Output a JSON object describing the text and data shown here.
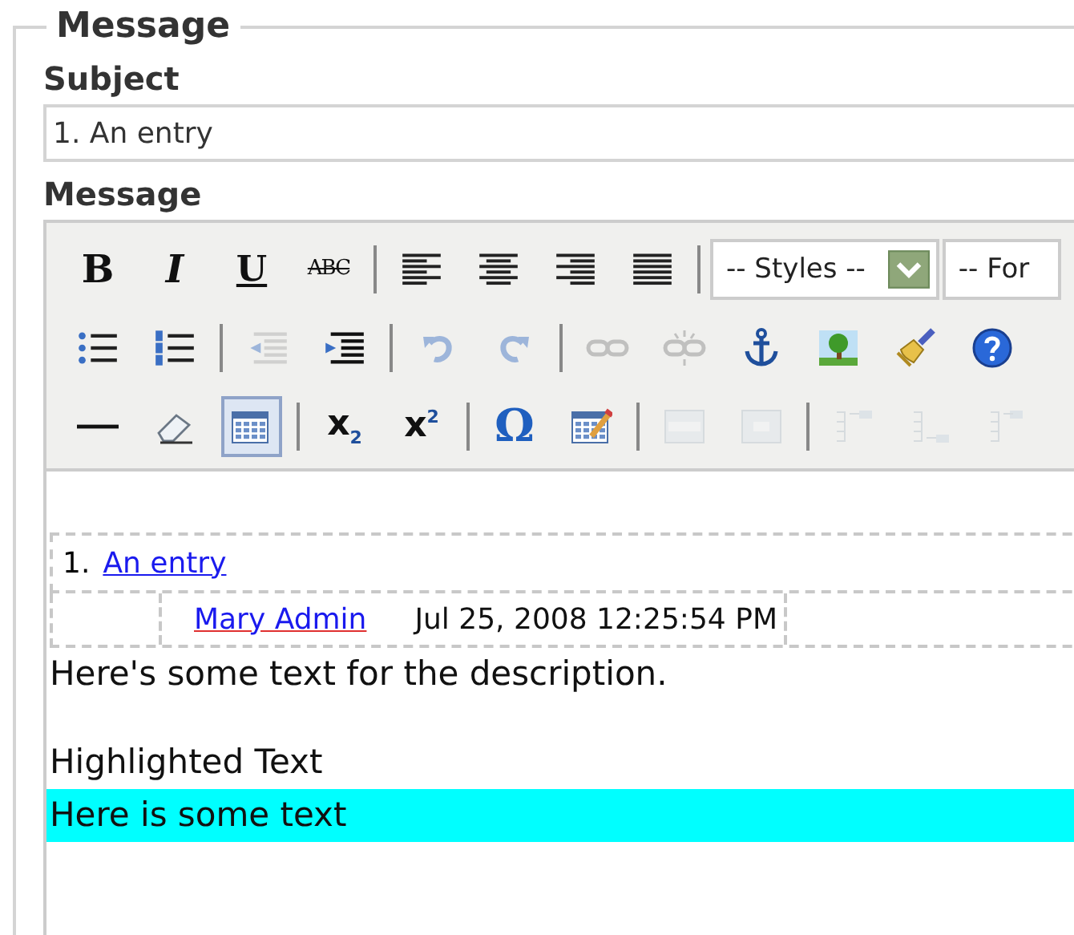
{
  "fieldset": {
    "legend": "Message"
  },
  "subject": {
    "label": "Subject",
    "value": "1. An entry"
  },
  "message_label": "Message",
  "toolbar": {
    "rows": [
      [
        {
          "kind": "bold",
          "label": "B",
          "disabled": false,
          "selected": false
        },
        {
          "kind": "italic",
          "label": "I",
          "disabled": false,
          "selected": false
        },
        {
          "kind": "underline",
          "label": "U",
          "disabled": false,
          "selected": false
        },
        {
          "kind": "strikethrough",
          "label": "ABC",
          "disabled": false,
          "selected": false
        },
        {
          "kind": "sep"
        },
        {
          "kind": "align-left",
          "disabled": false,
          "selected": false
        },
        {
          "kind": "align-center",
          "disabled": false,
          "selected": false
        },
        {
          "kind": "align-right",
          "disabled": false,
          "selected": false
        },
        {
          "kind": "justify",
          "disabled": false,
          "selected": false
        },
        {
          "kind": "sep"
        },
        {
          "kind": "select",
          "value": "-- Styles --"
        },
        {
          "kind": "select",
          "value": "-- For"
        }
      ],
      [
        {
          "kind": "bullet-list",
          "disabled": false,
          "selected": false
        },
        {
          "kind": "numbered-list",
          "disabled": false,
          "selected": false
        },
        {
          "kind": "sep"
        },
        {
          "kind": "outdent",
          "disabled": true,
          "selected": false
        },
        {
          "kind": "indent",
          "disabled": false,
          "selected": false
        },
        {
          "kind": "sep"
        },
        {
          "kind": "undo",
          "disabled": true,
          "selected": false
        },
        {
          "kind": "redo",
          "disabled": true,
          "selected": false
        },
        {
          "kind": "sep"
        },
        {
          "kind": "link",
          "disabled": true,
          "selected": false
        },
        {
          "kind": "unlink",
          "disabled": true,
          "selected": false
        },
        {
          "kind": "anchor",
          "disabled": false,
          "selected": false
        },
        {
          "kind": "image",
          "disabled": false,
          "selected": false
        },
        {
          "kind": "cleanup",
          "disabled": false,
          "selected": false
        },
        {
          "kind": "help",
          "disabled": false,
          "selected": false
        }
      ],
      [
        {
          "kind": "horizontal-rule",
          "disabled": false,
          "selected": false
        },
        {
          "kind": "eraser",
          "disabled": false,
          "selected": false
        },
        {
          "kind": "table",
          "disabled": false,
          "selected": true
        },
        {
          "kind": "sep"
        },
        {
          "kind": "subscript",
          "label": "x$_{2}$",
          "disabled": false,
          "selected": false
        },
        {
          "kind": "superscript",
          "label": "x$^{2}$",
          "disabled": false,
          "selected": false
        },
        {
          "kind": "sep"
        },
        {
          "kind": "special-char",
          "label": "Ω",
          "disabled": false,
          "selected": false
        },
        {
          "kind": "edit-table",
          "disabled": false,
          "selected": false
        },
        {
          "kind": "sep"
        },
        {
          "kind": "row-props",
          "disabled": true,
          "selected": false
        },
        {
          "kind": "cell-props",
          "disabled": true,
          "selected": false
        },
        {
          "kind": "sep"
        },
        {
          "kind": "row-before",
          "disabled": true,
          "selected": false
        },
        {
          "kind": "row-after",
          "disabled": true,
          "selected": false
        },
        {
          "kind": "col-before",
          "disabled": true,
          "selected": false
        }
      ]
    ]
  },
  "content": {
    "entry_number": "1.",
    "entry_link": "An entry",
    "author": "Mary Admin",
    "date": "Jul 25, 2008 12:25:54 PM",
    "description": "Here's some text for the description.",
    "paragraphs": [
      {
        "text": "Highlighted Text",
        "highlighted": false
      },
      {
        "text": "Here is some text",
        "highlighted": true
      }
    ]
  }
}
